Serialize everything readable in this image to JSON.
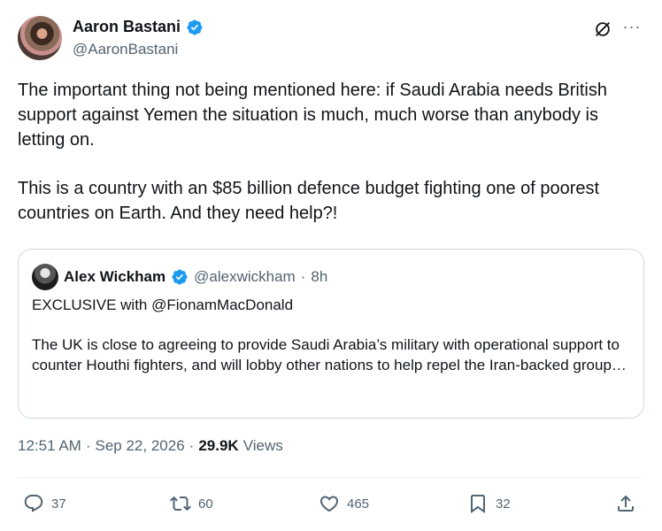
{
  "author": {
    "name": "Aaron Bastani",
    "handle": "@AaronBastani",
    "verified": true
  },
  "tweet": {
    "paragraphs": [
      "The important thing not being mentioned here: if Saudi Arabia needs British support against Yemen the situation is much, much worse than anybody is letting on.",
      "This is a country with an $85 billion defence budget fighting one of poorest countries on Earth. And they need help?!"
    ]
  },
  "quote": {
    "name": "Alex Wickham",
    "handle": "@alexwickham",
    "separator": "·",
    "time": "8h",
    "paragraphs": [
      "EXCLUSIVE with @FionamMacDonald",
      "The UK is close to agreeing to provide Saudi Arabia’s military with operational support to counter Houthi fighters, and will lobby other nations to help repel the Iran-backed group…"
    ]
  },
  "meta": {
    "time": "12:51 AM",
    "sep1": "·",
    "date": "Sep 22, 2026",
    "sep2": "·",
    "views_count": "29.9K",
    "views_label": "Views"
  },
  "actions": {
    "replies": "37",
    "reposts": "60",
    "likes": "465",
    "bookmarks": "32"
  },
  "icons": {
    "verified": "verified-badge-icon",
    "grok": "grok-icon",
    "more": "more-icon",
    "reply": "reply-icon",
    "repost": "repost-icon",
    "like": "heart-icon",
    "bookmark": "bookmark-icon",
    "share": "share-icon"
  },
  "colors": {
    "verified": "#1d9bf0",
    "text": "#0f1419",
    "secondary": "#536471",
    "border": "#cfd9de"
  }
}
